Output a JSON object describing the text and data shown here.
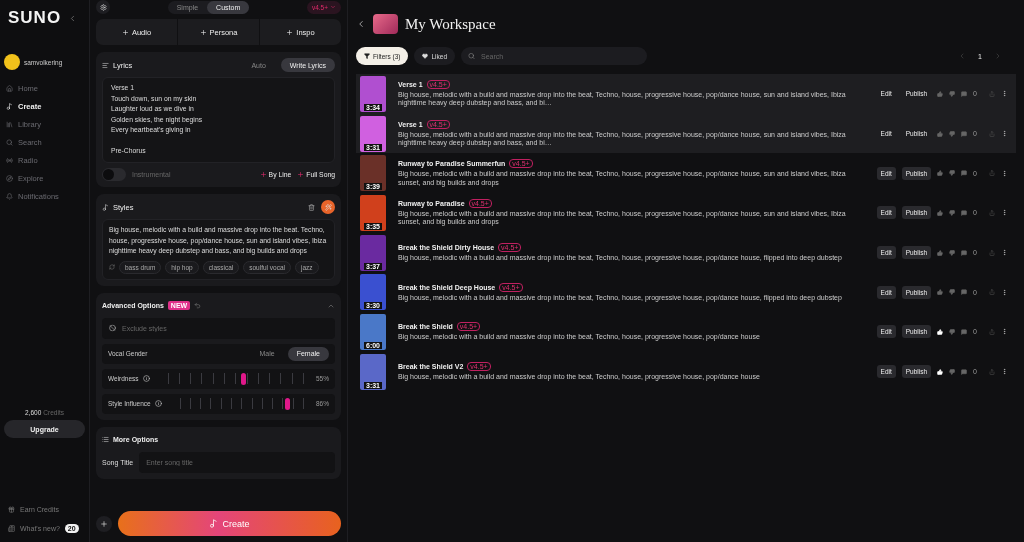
{
  "sidebar": {
    "logo": "SUNO",
    "user": {
      "name": "samvolkering"
    },
    "nav": [
      {
        "label": "Home",
        "selected": false
      },
      {
        "label": "Create",
        "selected": true
      },
      {
        "label": "Library",
        "selected": false
      },
      {
        "label": "Search",
        "selected": false
      },
      {
        "label": "Radio",
        "selected": false
      },
      {
        "label": "Explore",
        "selected": false
      },
      {
        "label": "Notifications",
        "selected": false
      }
    ],
    "credits": {
      "amount": "2,600",
      "label": "Credits"
    },
    "upgrade": "Upgrade",
    "footer": [
      {
        "label": "Earn Credits"
      },
      {
        "label": "What's new?",
        "badge": "20"
      }
    ]
  },
  "create_panel": {
    "modes": [
      {
        "label": "Simple",
        "selected": false
      },
      {
        "label": "Custom",
        "selected": true
      }
    ],
    "version": "v4.5+",
    "add_buttons": [
      "Audio",
      "Persona",
      "Inspo"
    ],
    "lyrics": {
      "title": "Lyrics",
      "modes": [
        {
          "label": "Auto",
          "selected": false
        },
        {
          "label": "Write Lyrics",
          "selected": true
        }
      ],
      "text": "Verse 1\nTouch down, sun on my skin\nLaughter loud as we dive in\nGolden skies, the night begins\nEvery heartbeat's giving in\n\nPre-Chorus",
      "instrumental": {
        "label": "Instrumental",
        "on": false
      },
      "actions": [
        "By Line",
        "Full Song"
      ]
    },
    "styles": {
      "title": "Styles",
      "text": "Big house, melodic with a build and massive drop into the beat. Techno, house, progressive house, pop/dance house, sun and island vibes, Ibiza nighttime heavy deep dubstep and bass, and big builds and drops",
      "tags": [
        "bass drum",
        "hip hop",
        "classical",
        "soulful vocal",
        "jazz"
      ]
    },
    "advanced": {
      "title": "Advanced Options",
      "badge": "NEW",
      "expanded": true,
      "exclude_placeholder": "Exclude styles",
      "vocal_gender": {
        "label": "Vocal Gender",
        "options": [
          {
            "label": "Male",
            "selected": false
          },
          {
            "label": "Female",
            "selected": true
          }
        ]
      },
      "sliders": [
        {
          "label": "Weirdness",
          "level": 0.55,
          "reading": "55%"
        },
        {
          "label": "Style Influence",
          "level": 0.86,
          "reading": "86%"
        }
      ]
    },
    "more_options": {
      "title": "More Options",
      "song_title": {
        "label": "Song Title",
        "placeholder": "Enter song title"
      }
    },
    "create_button": "Create"
  },
  "workspace": {
    "title": "My Workspace",
    "filters": "Filters (3)",
    "liked": "Liked",
    "search": {
      "placeholder": "Search"
    },
    "page": "1",
    "songs": [
      {
        "title": "Verse 1",
        "version": "v4.5+",
        "description": "Big house, melodic with a build and massive drop into the beat, Techno, house, progressive house, pop/dance house, sun and island vibes, Ibiza nighttime heavy deep dubstep and bass, and bi…",
        "duration": "3:34",
        "color": "#b04fd0",
        "selected": true,
        "liked": false,
        "comments": "0",
        "actions": [
          "Edit",
          "Publish"
        ]
      },
      {
        "title": "Verse 1",
        "version": "v4.5+",
        "description": "Big house, melodic with a build and massive drop into the beat, Techno, house, progressive house, pop/dance house, sun and island vibes, Ibiza nighttime heavy deep dubstep and bass, and bi…",
        "duration": "3:31",
        "color": "#d060e0",
        "selected": true,
        "liked": false,
        "comments": "0",
        "actions": [
          "Edit",
          "Publish"
        ]
      },
      {
        "title": "Runway to Paradise Summerfun",
        "version": "v4.5+",
        "description": "Big house, melodic with a build and massive drop into the beat, Techno, house, progressive house, pop/dance house, sun and island vibes, Ibiza sunset, and big builds and drops",
        "duration": "3:39",
        "color": "#6a3028",
        "selected": false,
        "liked": false,
        "comments": "0",
        "actions": [
          "Edit",
          "Publish"
        ]
      },
      {
        "title": "Runway to Paradise",
        "version": "v4.5+",
        "description": "Big house, melodic with a build and massive drop into the beat, Techno, house, progressive house, pop/dance house, sun and island vibes, Ibiza sunset, and big builds and drops",
        "duration": "3:35",
        "color": "#d0401c",
        "selected": false,
        "liked": false,
        "comments": "0",
        "actions": [
          "Edit",
          "Publish"
        ]
      },
      {
        "title": "Break the Shield Dirty House",
        "version": "v4.5+",
        "description": "Big house, melodic with a build and massive drop into the beat, Techno, house, progressive house, pop/dance house, flipped into deep dubstep",
        "duration": "3:37",
        "color": "#6a2aa0",
        "selected": false,
        "liked": false,
        "comments": "0",
        "actions": [
          "Edit",
          "Publish"
        ]
      },
      {
        "title": "Break the Shield Deep House",
        "version": "v4.5+",
        "description": "Big house, melodic with a build and massive drop into the beat, Techno, house, progressive house, pop/dance house, flipped into deep dubstep",
        "duration": "3:30",
        "color": "#3a50d0",
        "selected": false,
        "liked": false,
        "comments": "0",
        "actions": [
          "Edit",
          "Publish"
        ]
      },
      {
        "title": "Break the Shield",
        "version": "v4.5+",
        "description": "Big house, melodic with a build and massive drop into the beat, Techno, house, progressive house, pop/dance house",
        "duration": "6:00",
        "color": "#4a78c8",
        "selected": false,
        "liked": true,
        "comments": "0",
        "actions": [
          "Edit",
          "Publish"
        ]
      },
      {
        "title": "Break the Shield V2",
        "version": "v4.5+",
        "description": "Big house, melodic with a build and massive drop into the beat, Techno, house, progressive house, pop/dance house",
        "duration": "3:31",
        "color": "#5a68c8",
        "selected": false,
        "liked": true,
        "comments": "0",
        "actions": [
          "Edit",
          "Publish"
        ]
      }
    ]
  }
}
